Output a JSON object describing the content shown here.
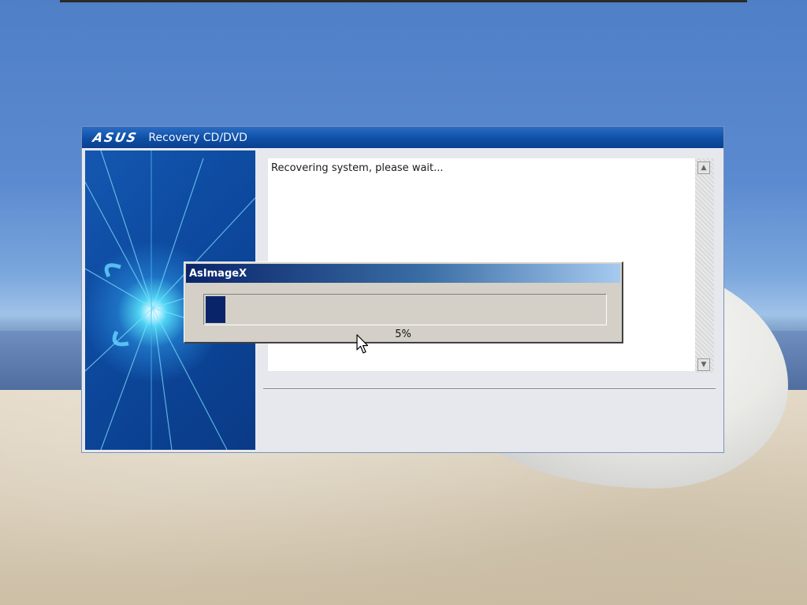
{
  "recovery_window": {
    "brand": "ASUS",
    "title": "Recovery CD/DVD",
    "log_text": "Recovering system, please wait..."
  },
  "progress_dialog": {
    "title": "AsImageX",
    "percent": 5,
    "percent_label": "5%"
  },
  "colors": {
    "window_title_bar": "#0e4fa6",
    "dialog_title_bar_start": "#0a246a",
    "progress_fill": "#0a246a",
    "dialog_face": "#d4d0c8"
  },
  "icons": {
    "scroll_up": "scroll-up-arrow-icon",
    "scroll_down": "scroll-down-arrow-icon",
    "cursor": "mouse-pointer-icon"
  }
}
